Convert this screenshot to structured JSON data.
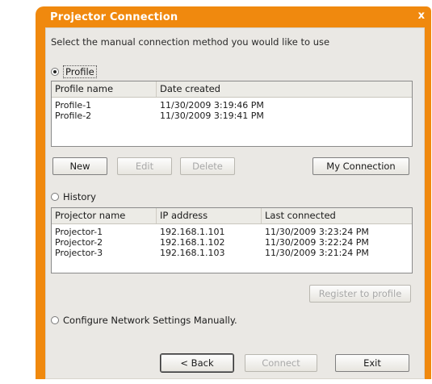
{
  "window": {
    "title": "Projector Connection",
    "close_glyph": "x"
  },
  "instruction": "Select the manual connection method you would like to use",
  "profile": {
    "radio_label": "Profile",
    "checked": true,
    "columns": [
      "Profile name",
      "Date created"
    ],
    "rows": [
      [
        "Profile-1",
        "11/30/2009 3:19:46 PM"
      ],
      [
        "Profile-2",
        "11/30/2009 3:19:41 PM"
      ]
    ],
    "buttons": {
      "new": "New",
      "edit": "Edit",
      "delete": "Delete",
      "my_connection": "My Connection"
    }
  },
  "history": {
    "radio_label": "History",
    "checked": false,
    "columns": [
      "Projector name",
      "IP address",
      "Last connected"
    ],
    "rows": [
      [
        "Projector-1",
        "192.168.1.101",
        "11/30/2009 3:23:24 PM"
      ],
      [
        "Projector-2",
        "192.168.1.102",
        "11/30/2009 3:22:24 PM"
      ],
      [
        "Projector-3",
        "192.168.1.103",
        "11/30/2009 3:21:24 PM"
      ]
    ],
    "register_button": "Register to profile"
  },
  "network": {
    "radio_label": "Configure Network Settings Manually."
  },
  "footer": {
    "back": "< Back",
    "connect": "Connect",
    "exit": "Exit"
  },
  "colors": {
    "title_bar": "#f0890e",
    "dialog_bg": "#eae8e4"
  }
}
